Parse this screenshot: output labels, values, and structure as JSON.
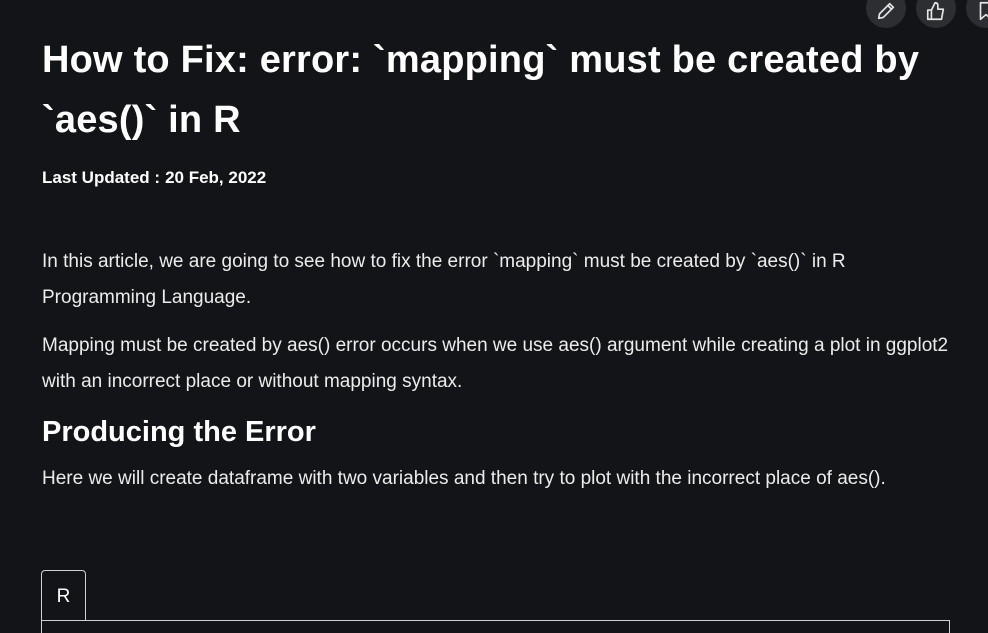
{
  "article": {
    "title": "How to Fix: error: `mapping` must be created by `aes()` in R",
    "updated_label": "Last Updated :",
    "updated_date": "20 Feb, 2022",
    "paragraphs": [
      "In this article, we are going to see how to fix the error `mapping` must be created by `aes()` in R Programming Language.",
      "Mapping must be created by aes() error occurs when we use aes() argument while creating a plot in ggplot2 with an incorrect place or without mapping syntax."
    ],
    "section_heading": "Producing the Error",
    "section_paragraph": "Here we will create dataframe with two variables and then try to plot with the incorrect place of aes().",
    "code_tab_label": "R"
  },
  "actions": {
    "icons": [
      "pencil-icon",
      "thumbs-up-icon",
      "bookmark-icon"
    ]
  },
  "colors": {
    "background": "#131417",
    "action_button": "#2d2e32",
    "text": "#ffffff"
  }
}
